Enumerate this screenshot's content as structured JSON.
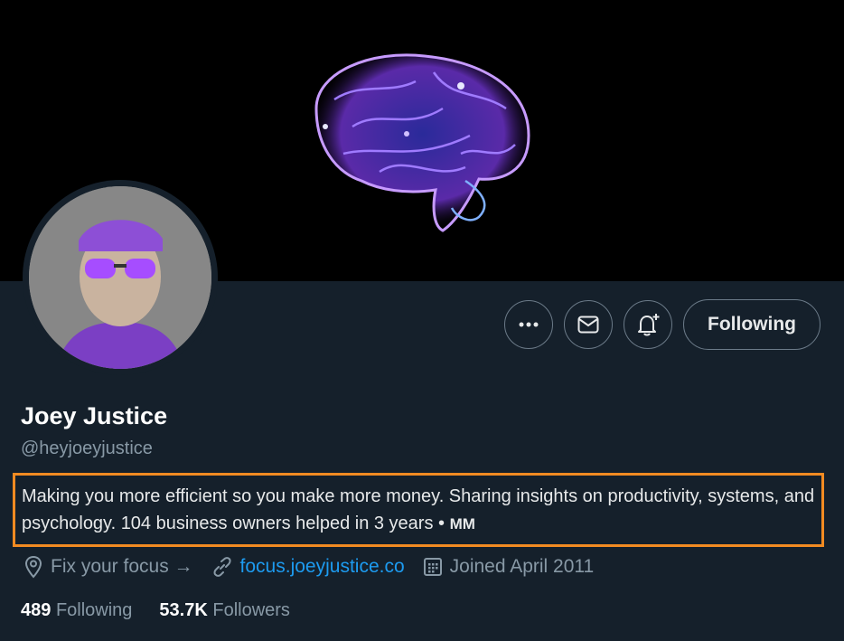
{
  "profile": {
    "name": "Joey Justice",
    "handle": "@heyjoeyjustice",
    "bio_text": "Making you more efficient so you make more money. Sharing insights on productivity, systems, and psychology. 104 business owners helped in 3 years • ",
    "bio_mm": "MM",
    "location": "Fix your focus →",
    "website": "focus.joeyjustice.co",
    "joined": "Joined April 2011",
    "following_count": "489",
    "following_label": "Following",
    "followers_count": "53.7K",
    "followers_label": "Followers"
  },
  "actions": {
    "more_icon": "more-icon",
    "message_icon": "mail-icon",
    "notify_icon": "bell-plus-icon",
    "follow_label": "Following"
  },
  "colors": {
    "background": "#15202b",
    "highlight": "#f28b22",
    "link": "#1d9bf0"
  }
}
